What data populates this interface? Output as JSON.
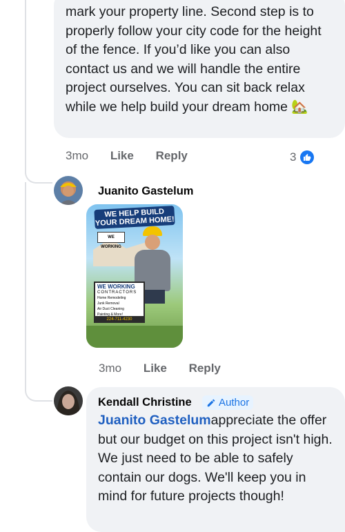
{
  "comment1": {
    "text": "mark your property line. Second step is to properly follow your city code for the height of the fence. If you’d like you can also contact us and we will handle the entire project ourselves. You can sit back relax while we help build your dream home 🏡",
    "time": "3mo",
    "like_label": "Like",
    "reply_label": "Reply",
    "reaction_count": "3"
  },
  "reply1": {
    "author": "Juanito Gastelum",
    "time": "3mo",
    "like_label": "Like",
    "reply_label": "Reply",
    "image": {
      "headline_line1": "WE HELP BUILD",
      "headline_line2": "YOUR DREAM HOME!",
      "company": "WE WORKING",
      "company_sub": "CONTRACTORS",
      "services": [
        "Home Remodeling",
        "Junk Removal",
        "Air Duct Cleaning",
        "Painting & More!"
      ],
      "phone": "224-711-4230"
    }
  },
  "reply2": {
    "author": "Kendall Christine",
    "badge": "Author",
    "mention": "Juanito Gastelum",
    "text": "appreciate the offer but our budget on this project isn't high.  We just need to be able to safely contain our dogs.  We'll keep you in mind for future projects though!"
  },
  "colors": {
    "bubble": "#f0f2f5",
    "accent": "#1877f2",
    "meta": "#65676b"
  }
}
